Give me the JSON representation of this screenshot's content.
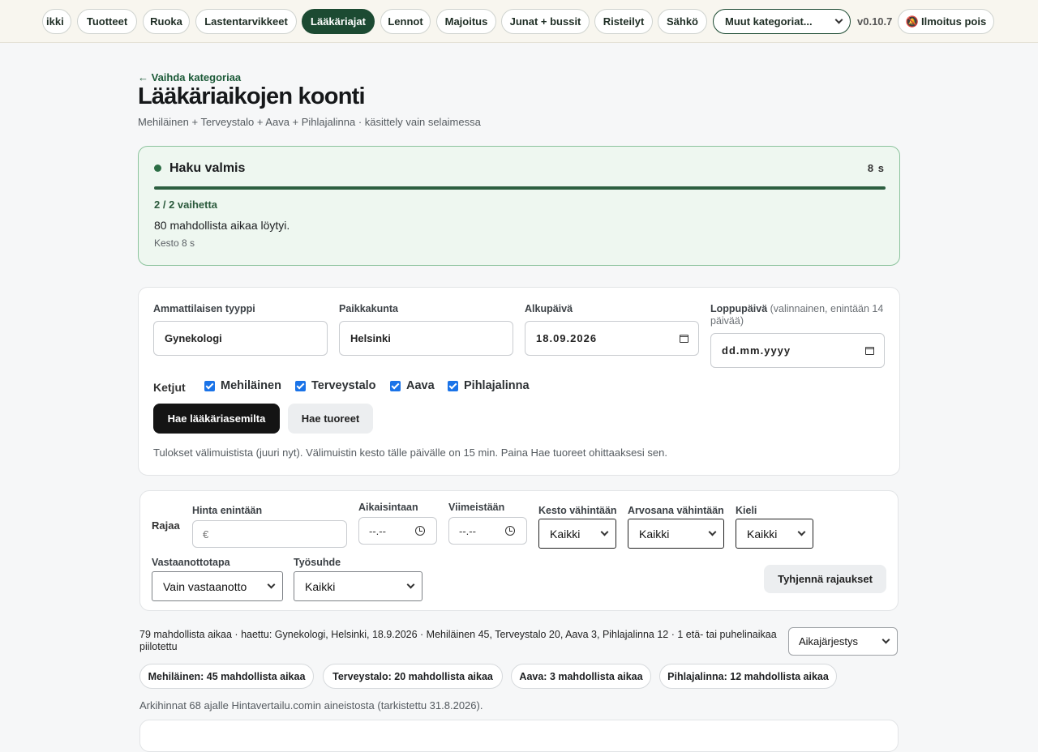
{
  "nav": {
    "categories": [
      {
        "label": "Sähkö"
      },
      {
        "label": "Tuotteet"
      },
      {
        "label": "Ruoka"
      },
      {
        "label": "Lastentarvikkeet"
      },
      {
        "label": "Lääkäriajat"
      },
      {
        "label": "Lennot"
      },
      {
        "label": "Majoitus"
      },
      {
        "label": "Junat + bussit"
      },
      {
        "label": "Risteilyt"
      },
      {
        "label": "Sähkö"
      }
    ],
    "partial_first_label": "ikki",
    "active_label": "Lääkäriajat",
    "more_categories": "Muut kategoriat...",
    "version": "v0.10.7",
    "notify_label": "Ilmoitus pois",
    "notify_icon": "bell-off-icon"
  },
  "header": {
    "back_link": "← Vaihda kategoriaa",
    "title": "Lääkäriaikojen koonti",
    "subtitle": "Mehiläinen + Terveystalo + Aava + Pihlajalinna · käsittely vain selaimessa"
  },
  "status": {
    "title": "Haku valmis",
    "elapsed": "8 s",
    "progress_fraction": 1.0,
    "stage": "2 / 2 vaihetta",
    "found": "80 mahdollista aikaa löytyi.",
    "duration": "Kesto 8 s",
    "accent": "#2c6e45"
  },
  "search": {
    "type_label": "Ammattilaisen tyyppi",
    "type_value": "Gynekologi",
    "city_label": "Paikkakunta",
    "city_value": "Helsinki",
    "start_label": "Alkupäivä",
    "start_value": "18.09.2026",
    "end_label": "Loppupäivä",
    "end_hint": "(valinnainen, enintään 14 päivää)",
    "end_placeholder": "dd.mm.yyyy",
    "chains_label": "Ketjut",
    "chains": [
      {
        "label": "Mehiläinen",
        "checked": true
      },
      {
        "label": "Terveystalo",
        "checked": true
      },
      {
        "label": "Aava",
        "checked": true
      },
      {
        "label": "Pihlajalinna",
        "checked": true
      }
    ],
    "search_button": "Hae lääkäriasemilta",
    "refresh_button": "Hae tuoreet",
    "cache_note": "Tulokset välimuistista (juuri nyt). Välimuistin kesto tälle päivälle on 15 min. Paina Hae tuoreet ohittaaksesi sen."
  },
  "filters": {
    "title": "Rajaa",
    "max_price_label": "Hinta enintään",
    "max_price_placeholder": "€",
    "earliest_label": "Aikaisintaan",
    "earliest_value": "--.--",
    "latest_label": "Viimeistään",
    "latest_value": "--.--",
    "min_duration_label": "Kesto vähintään",
    "min_duration_value": "Kaikki",
    "min_rating_label": "Arvosana vähintään",
    "min_rating_value": "Kaikki",
    "language_label": "Kieli",
    "language_value": "Kaikki",
    "mode_label": "Vastaanottotapa",
    "mode_value": "Vain vastaanotto",
    "employment_label": "Työsuhde",
    "employment_value": "Kaikki",
    "clear_button": "Tyhjennä rajaukset"
  },
  "results": {
    "summary": "79 mahdollista aikaa · haettu: Gynekologi, Helsinki, 18.9.2026 · Mehiläinen 45, Terveystalo 20, Aava 3, Pihlajalinna 12 · 1 etä- tai puhelinaikaa piilotettu",
    "sort_value": "Aikajärjestys",
    "chips": [
      {
        "label": "Mehiläinen: 45 mahdollista aikaa"
      },
      {
        "label": "Terveystalo: 20 mahdollista aikaa"
      },
      {
        "label": "Aava: 3 mahdollista aikaa"
      },
      {
        "label": "Pihlajalinna: 12 mahdollista aikaa"
      }
    ],
    "prices_note": "Arkihinnat 68 ajalle Hintavertailu.comin aineistosta (tarkistettu 31.8.2026)."
  }
}
